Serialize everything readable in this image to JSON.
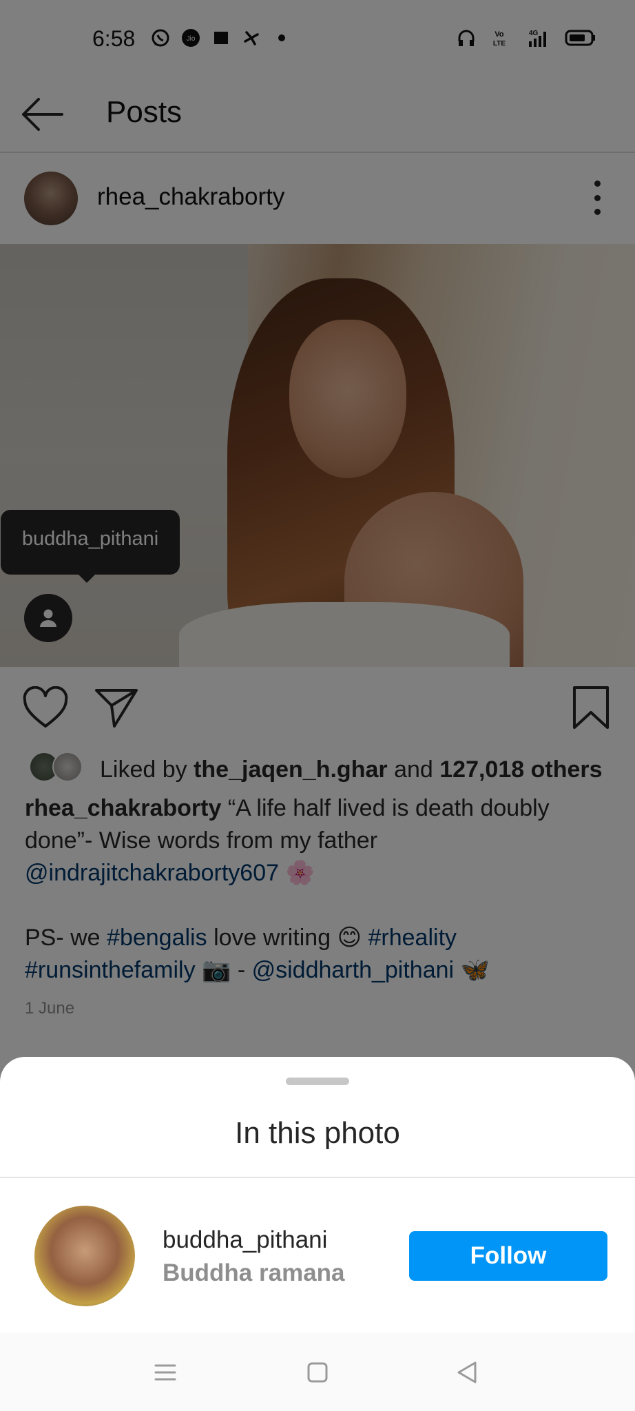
{
  "status_bar": {
    "time": "6:58",
    "left_icons": [
      "whatsapp-icon",
      "jio-icon",
      "clapperboard-icon",
      "pinwheel-icon",
      "dot-icon"
    ],
    "right_icons": [
      "headphones-icon",
      "volte-icon",
      "signal-4g-icon",
      "battery-icon"
    ],
    "volte_label": "Vo LTE",
    "network_label": "4G"
  },
  "header": {
    "title": "Posts"
  },
  "post": {
    "author": "rhea_chakraborty",
    "tag_tooltip": "buddha_pithani",
    "likes": {
      "prefix": "Liked by",
      "liker": "the_jaqen_h.ghar",
      "middle": "and",
      "others": "127,018 others"
    },
    "caption": {
      "username": "rhea_chakraborty",
      "text1": "“A life half lived is death doubly done”- Wise words from my father",
      "mention1": "@indrajitchakraborty607",
      "emoji1": "🌸",
      "ps_text": "PS- we",
      "hashtag1": "#bengalis",
      "text2": "love writing",
      "emoji2": "😊",
      "hashtag2": "#rheality",
      "hashtag3": "#runsinthefamily",
      "emoji3": "📷",
      "dash": "-",
      "mention2": "@siddharth_pithani",
      "emoji4": "🦋"
    },
    "date": "1 June"
  },
  "sheet": {
    "title": "In this photo",
    "tagged": {
      "username": "buddha_pithani",
      "full_name": "Buddha ramana",
      "button": "Follow"
    }
  },
  "colors": {
    "accent": "#0095f6",
    "link": "#00376b",
    "text": "#262626",
    "secondary": "#8e8e8e"
  }
}
